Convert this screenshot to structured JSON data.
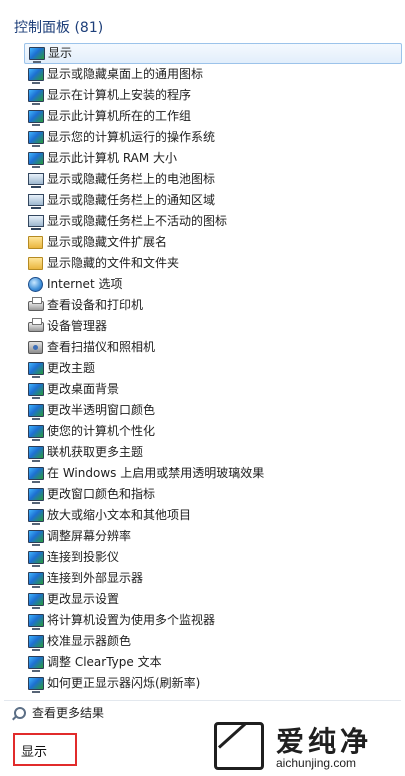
{
  "panel": {
    "header": "控制面板 (81)",
    "items": [
      {
        "label": "显示",
        "icon": "display-monitor-icon",
        "selected": true
      },
      {
        "label": "显示或隐藏桌面上的通用图标",
        "icon": "display-monitor-icon"
      },
      {
        "label": "显示在计算机上安装的程序",
        "icon": "display-monitor-icon"
      },
      {
        "label": "显示此计算机所在的工作组",
        "icon": "system-shield-icon"
      },
      {
        "label": "显示您的计算机运行的操作系统",
        "icon": "system-shield-icon"
      },
      {
        "label": "显示此计算机 RAM 大小",
        "icon": "system-shield-icon"
      },
      {
        "label": "显示或隐藏任务栏上的电池图标",
        "icon": "taskbar-monitor-icon"
      },
      {
        "label": "显示或隐藏任务栏上的通知区域",
        "icon": "taskbar-monitor-icon"
      },
      {
        "label": "显示或隐藏任务栏上不活动的图标",
        "icon": "taskbar-monitor-icon"
      },
      {
        "label": "显示或隐藏文件扩展名",
        "icon": "folder-options-icon"
      },
      {
        "label": "显示隐藏的文件和文件夹",
        "icon": "folder-options-icon"
      },
      {
        "label": "Internet 选项",
        "icon": "internet-globe-icon"
      },
      {
        "label": "查看设备和打印机",
        "icon": "printer-icon"
      },
      {
        "label": "设备管理器",
        "icon": "printer-icon"
      },
      {
        "label": "查看扫描仪和照相机",
        "icon": "scanner-camera-icon"
      },
      {
        "label": "更改主题",
        "icon": "display-monitor-icon"
      },
      {
        "label": "更改桌面背景",
        "icon": "display-monitor-icon"
      },
      {
        "label": "更改半透明窗口颜色",
        "icon": "display-monitor-icon"
      },
      {
        "label": "使您的计算机个性化",
        "icon": "display-monitor-icon"
      },
      {
        "label": "联机获取更多主题",
        "icon": "display-monitor-icon"
      },
      {
        "label": "在 Windows 上启用或禁用透明玻璃效果",
        "icon": "display-monitor-icon"
      },
      {
        "label": "更改窗口颜色和指标",
        "icon": "display-monitor-icon"
      },
      {
        "label": "放大或缩小文本和其他项目",
        "icon": "display-monitor-icon"
      },
      {
        "label": "调整屏幕分辨率",
        "icon": "display-monitor-icon"
      },
      {
        "label": "连接到投影仪",
        "icon": "display-monitor-icon"
      },
      {
        "label": "连接到外部显示器",
        "icon": "display-monitor-icon"
      },
      {
        "label": "更改显示设置",
        "icon": "display-monitor-icon"
      },
      {
        "label": "将计算机设置为使用多个监视器",
        "icon": "display-monitor-icon"
      },
      {
        "label": "校准显示器颜色",
        "icon": "display-monitor-icon"
      },
      {
        "label": "调整 ClearType 文本",
        "icon": "display-monitor-icon"
      },
      {
        "label": "如何更正显示器闪烁(刷新率)",
        "icon": "display-monitor-icon"
      }
    ],
    "more_results": "查看更多结果",
    "more_results_icon": "magnifier-icon"
  },
  "search": {
    "value": "显示",
    "highlight_color": "#e12b2b"
  },
  "watermark": {
    "title": "爱纯净",
    "url": "aichunjing.com"
  },
  "colors": {
    "header": "#1e3f7a",
    "selection_border": "#9cc3ea",
    "selection_fill": "#e2eefb"
  }
}
